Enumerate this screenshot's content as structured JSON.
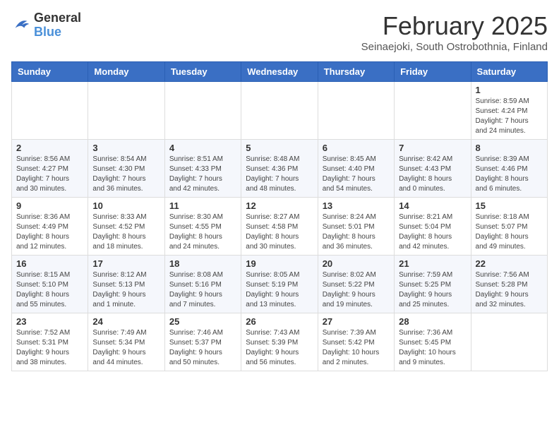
{
  "logo": {
    "general": "General",
    "blue": "Blue"
  },
  "header": {
    "month": "February 2025",
    "location": "Seinaejoki, South Ostrobothnia, Finland"
  },
  "weekdays": [
    "Sunday",
    "Monday",
    "Tuesday",
    "Wednesday",
    "Thursday",
    "Friday",
    "Saturday"
  ],
  "weeks": [
    [
      {
        "day": "",
        "info": ""
      },
      {
        "day": "",
        "info": ""
      },
      {
        "day": "",
        "info": ""
      },
      {
        "day": "",
        "info": ""
      },
      {
        "day": "",
        "info": ""
      },
      {
        "day": "",
        "info": ""
      },
      {
        "day": "1",
        "info": "Sunrise: 8:59 AM\nSunset: 4:24 PM\nDaylight: 7 hours\nand 24 minutes."
      }
    ],
    [
      {
        "day": "2",
        "info": "Sunrise: 8:56 AM\nSunset: 4:27 PM\nDaylight: 7 hours\nand 30 minutes."
      },
      {
        "day": "3",
        "info": "Sunrise: 8:54 AM\nSunset: 4:30 PM\nDaylight: 7 hours\nand 36 minutes."
      },
      {
        "day": "4",
        "info": "Sunrise: 8:51 AM\nSunset: 4:33 PM\nDaylight: 7 hours\nand 42 minutes."
      },
      {
        "day": "5",
        "info": "Sunrise: 8:48 AM\nSunset: 4:36 PM\nDaylight: 7 hours\nand 48 minutes."
      },
      {
        "day": "6",
        "info": "Sunrise: 8:45 AM\nSunset: 4:40 PM\nDaylight: 7 hours\nand 54 minutes."
      },
      {
        "day": "7",
        "info": "Sunrise: 8:42 AM\nSunset: 4:43 PM\nDaylight: 8 hours\nand 0 minutes."
      },
      {
        "day": "8",
        "info": "Sunrise: 8:39 AM\nSunset: 4:46 PM\nDaylight: 8 hours\nand 6 minutes."
      }
    ],
    [
      {
        "day": "9",
        "info": "Sunrise: 8:36 AM\nSunset: 4:49 PM\nDaylight: 8 hours\nand 12 minutes."
      },
      {
        "day": "10",
        "info": "Sunrise: 8:33 AM\nSunset: 4:52 PM\nDaylight: 8 hours\nand 18 minutes."
      },
      {
        "day": "11",
        "info": "Sunrise: 8:30 AM\nSunset: 4:55 PM\nDaylight: 8 hours\nand 24 minutes."
      },
      {
        "day": "12",
        "info": "Sunrise: 8:27 AM\nSunset: 4:58 PM\nDaylight: 8 hours\nand 30 minutes."
      },
      {
        "day": "13",
        "info": "Sunrise: 8:24 AM\nSunset: 5:01 PM\nDaylight: 8 hours\nand 36 minutes."
      },
      {
        "day": "14",
        "info": "Sunrise: 8:21 AM\nSunset: 5:04 PM\nDaylight: 8 hours\nand 42 minutes."
      },
      {
        "day": "15",
        "info": "Sunrise: 8:18 AM\nSunset: 5:07 PM\nDaylight: 8 hours\nand 49 minutes."
      }
    ],
    [
      {
        "day": "16",
        "info": "Sunrise: 8:15 AM\nSunset: 5:10 PM\nDaylight: 8 hours\nand 55 minutes."
      },
      {
        "day": "17",
        "info": "Sunrise: 8:12 AM\nSunset: 5:13 PM\nDaylight: 9 hours\nand 1 minute."
      },
      {
        "day": "18",
        "info": "Sunrise: 8:08 AM\nSunset: 5:16 PM\nDaylight: 9 hours\nand 7 minutes."
      },
      {
        "day": "19",
        "info": "Sunrise: 8:05 AM\nSunset: 5:19 PM\nDaylight: 9 hours\nand 13 minutes."
      },
      {
        "day": "20",
        "info": "Sunrise: 8:02 AM\nSunset: 5:22 PM\nDaylight: 9 hours\nand 19 minutes."
      },
      {
        "day": "21",
        "info": "Sunrise: 7:59 AM\nSunset: 5:25 PM\nDaylight: 9 hours\nand 25 minutes."
      },
      {
        "day": "22",
        "info": "Sunrise: 7:56 AM\nSunset: 5:28 PM\nDaylight: 9 hours\nand 32 minutes."
      }
    ],
    [
      {
        "day": "23",
        "info": "Sunrise: 7:52 AM\nSunset: 5:31 PM\nDaylight: 9 hours\nand 38 minutes."
      },
      {
        "day": "24",
        "info": "Sunrise: 7:49 AM\nSunset: 5:34 PM\nDaylight: 9 hours\nand 44 minutes."
      },
      {
        "day": "25",
        "info": "Sunrise: 7:46 AM\nSunset: 5:37 PM\nDaylight: 9 hours\nand 50 minutes."
      },
      {
        "day": "26",
        "info": "Sunrise: 7:43 AM\nSunset: 5:39 PM\nDaylight: 9 hours\nand 56 minutes."
      },
      {
        "day": "27",
        "info": "Sunrise: 7:39 AM\nSunset: 5:42 PM\nDaylight: 10 hours\nand 2 minutes."
      },
      {
        "day": "28",
        "info": "Sunrise: 7:36 AM\nSunset: 5:45 PM\nDaylight: 10 hours\nand 9 minutes."
      },
      {
        "day": "",
        "info": ""
      }
    ]
  ]
}
